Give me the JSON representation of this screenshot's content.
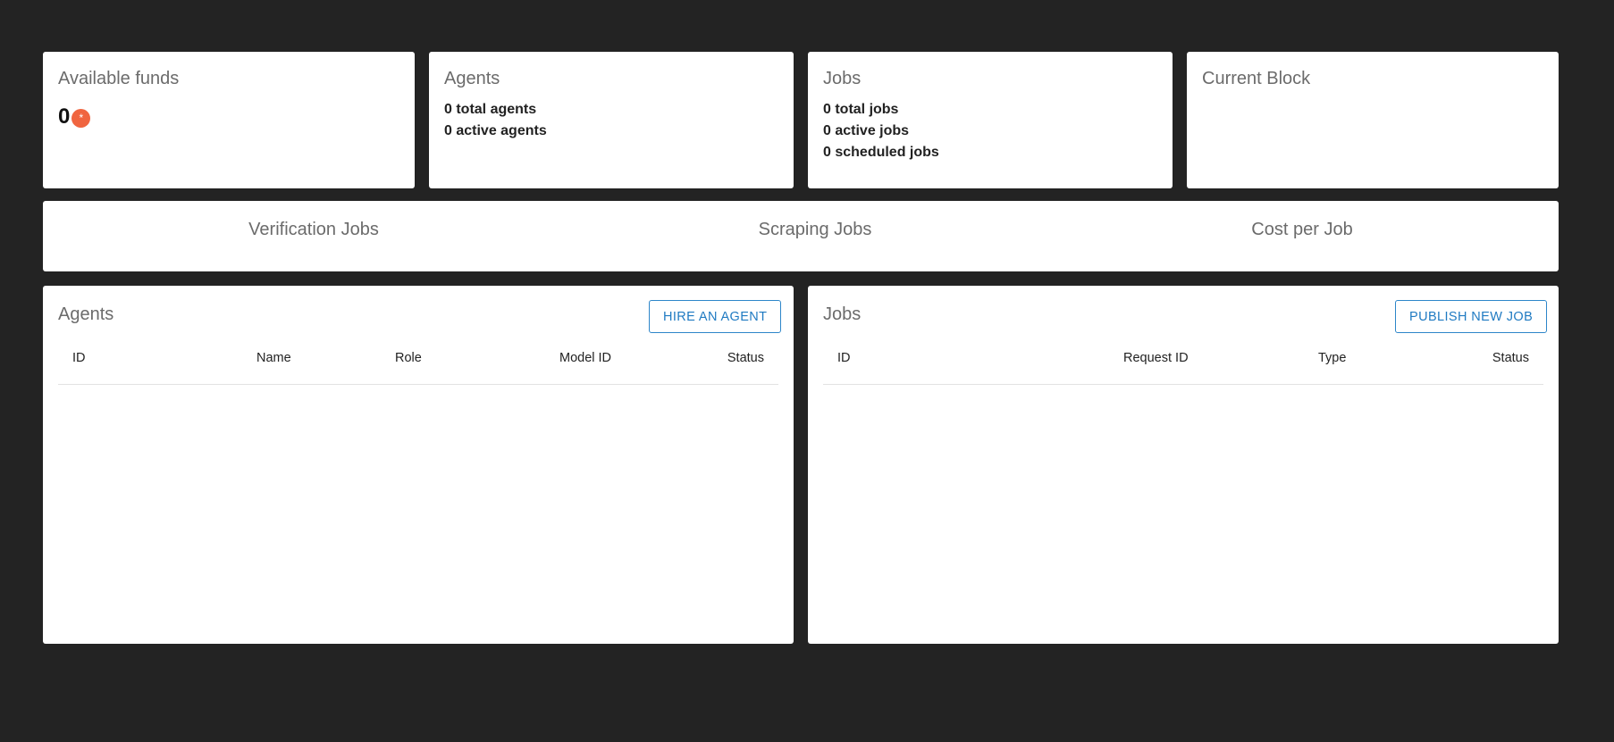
{
  "funds": {
    "title": "Available funds",
    "value": "0",
    "token_icon": "token-icon",
    "token_glyph": "*"
  },
  "agents_summary": {
    "title": "Agents",
    "total": "0 total agents",
    "active": "0 active agents"
  },
  "jobs_summary": {
    "title": "Jobs",
    "total": "0 total jobs",
    "active": "0 active jobs",
    "scheduled": "0 scheduled jobs"
  },
  "current_block": {
    "title": "Current Block"
  },
  "charts": {
    "verification": "Verification Jobs",
    "scraping": "Scraping Jobs",
    "cost": "Cost per Job"
  },
  "agents_table": {
    "title": "Agents",
    "button": "HIRE AN AGENT",
    "columns": [
      "ID",
      "Name",
      "Role",
      "Model ID",
      "Status"
    ],
    "rows": []
  },
  "jobs_table": {
    "title": "Jobs",
    "button": "PUBLISH NEW JOB",
    "columns": [
      "ID",
      "Request ID",
      "Type",
      "Status"
    ],
    "rows": []
  },
  "colors": {
    "background": "#232323",
    "card": "#ffffff",
    "accent": "#1f7ac2",
    "token": "#f06540"
  }
}
